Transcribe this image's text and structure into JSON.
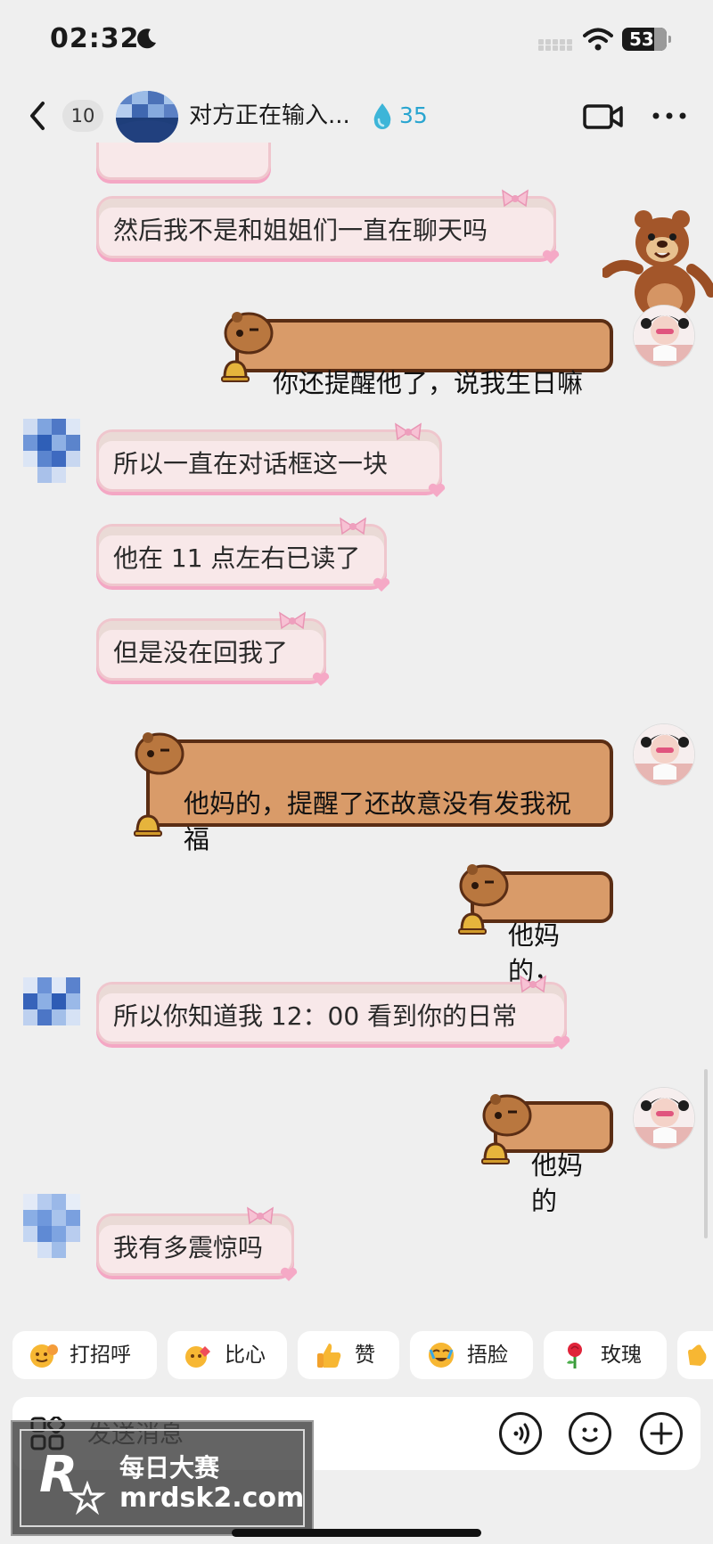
{
  "status_bar": {
    "time": "02:32",
    "battery": "53"
  },
  "header": {
    "unread_count": "10",
    "title": "对方正在输入...",
    "spark_count": "35"
  },
  "messages": [
    {
      "side": "left",
      "text": "然后我不是和姐姐们一直在聊天吗"
    },
    {
      "side": "right",
      "text": "你还提醒他了，说我生日嘛"
    },
    {
      "side": "left",
      "text": "所以一直在对话框这一块"
    },
    {
      "side": "left",
      "text": "他在 11 点左右已读了"
    },
    {
      "side": "left",
      "text": "但是没在回我了"
    },
    {
      "side": "right",
      "text": "他妈的，提醒了还故意没有发我祝\n福"
    },
    {
      "side": "right",
      "text": "他妈的，"
    },
    {
      "side": "left",
      "text": "所以你知道我 12：00 看到你的日常"
    },
    {
      "side": "right",
      "text": "他妈的"
    },
    {
      "side": "left",
      "text": "我有多震惊吗"
    }
  ],
  "quick_reactions": [
    {
      "label": "打招呼",
      "icon": "wave-face-icon"
    },
    {
      "label": "比心",
      "icon": "heart-hands-icon"
    },
    {
      "label": "赞",
      "icon": "thumbs-up-icon"
    },
    {
      "label": "捂脸",
      "icon": "facepalm-icon"
    },
    {
      "label": "玫瑰",
      "icon": "rose-icon"
    }
  ],
  "input": {
    "placeholder": "发送消息"
  },
  "watermark": {
    "line1": "每日大赛",
    "line2": "mrdsk2.com"
  },
  "colors": {
    "background": "#efefef",
    "pink_bubble": "#f8e8e9",
    "brown_bubble": "#d99b69",
    "brown_border": "#5a2d14",
    "accent_blue": "#29a5d0"
  }
}
